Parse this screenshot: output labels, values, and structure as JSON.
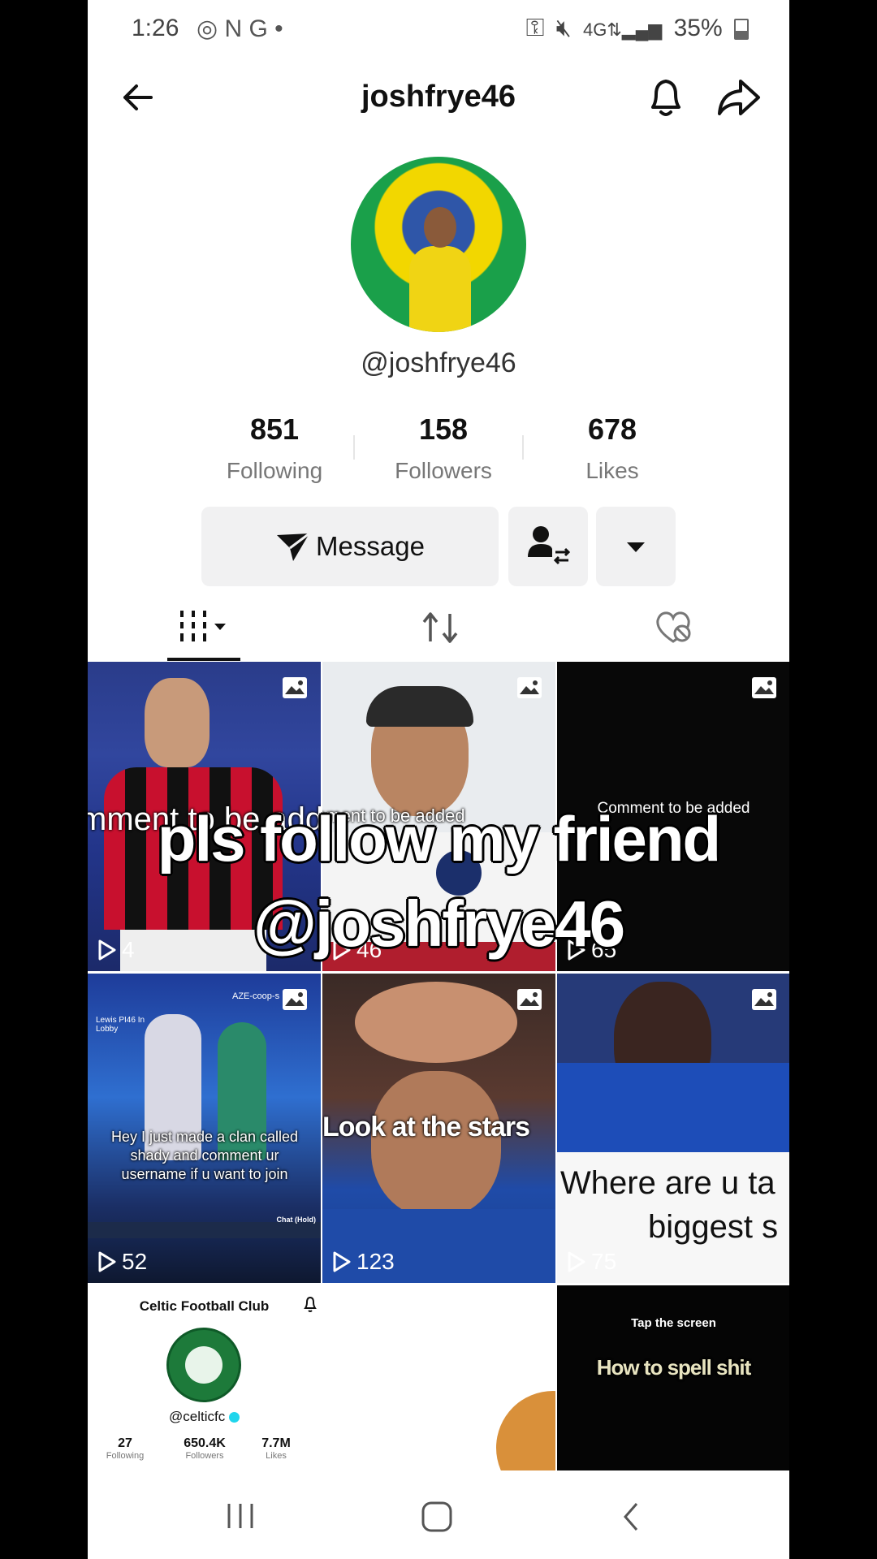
{
  "status_bar": {
    "time": "1:26",
    "notif_icons": "◎ N G •",
    "battery": "35%"
  },
  "header": {
    "title": "joshfrye46"
  },
  "profile": {
    "handle": "@joshfrye46",
    "stats": [
      {
        "value": "851",
        "label": "Following"
      },
      {
        "value": "158",
        "label": "Followers"
      },
      {
        "value": "678",
        "label": "Likes"
      }
    ],
    "message_label": "Message"
  },
  "overlay": {
    "line1": "pls follow my friend",
    "line2": "@joshfrye46"
  },
  "videos": [
    {
      "views": "4",
      "caption": "mment to be added"
    },
    {
      "views": "46",
      "caption": "mment to be added"
    },
    {
      "views": "65",
      "caption": "Comment to be added"
    },
    {
      "views": "52",
      "caption": "Hey I just made a clan called shady and comment ur username if u want to join",
      "game_tag": "Lewis PI46 In Lobby",
      "game_badge": "AZE-coop-s",
      "chat_label": "Chat (Hold)"
    },
    {
      "views": "123",
      "caption": "Look at the stars"
    },
    {
      "views": "75",
      "caption_line1": "Where are u ta",
      "caption_line2": "biggest s"
    }
  ],
  "celtic_card": {
    "name": "Celtic Football Club",
    "handle": "@celticfc",
    "stats": [
      {
        "value": "27",
        "label": "Following"
      },
      {
        "value": "650.4K",
        "label": "Followers"
      },
      {
        "value": "7.7M",
        "label": "Likes"
      }
    ]
  },
  "last_cell": {
    "top": "Tap the screen",
    "caption": "How to spell shit"
  },
  "colors": {
    "accent_blue": "#20d5ec",
    "milan_red": "#c8102e",
    "rangers_blue": "#1b4fb4"
  }
}
